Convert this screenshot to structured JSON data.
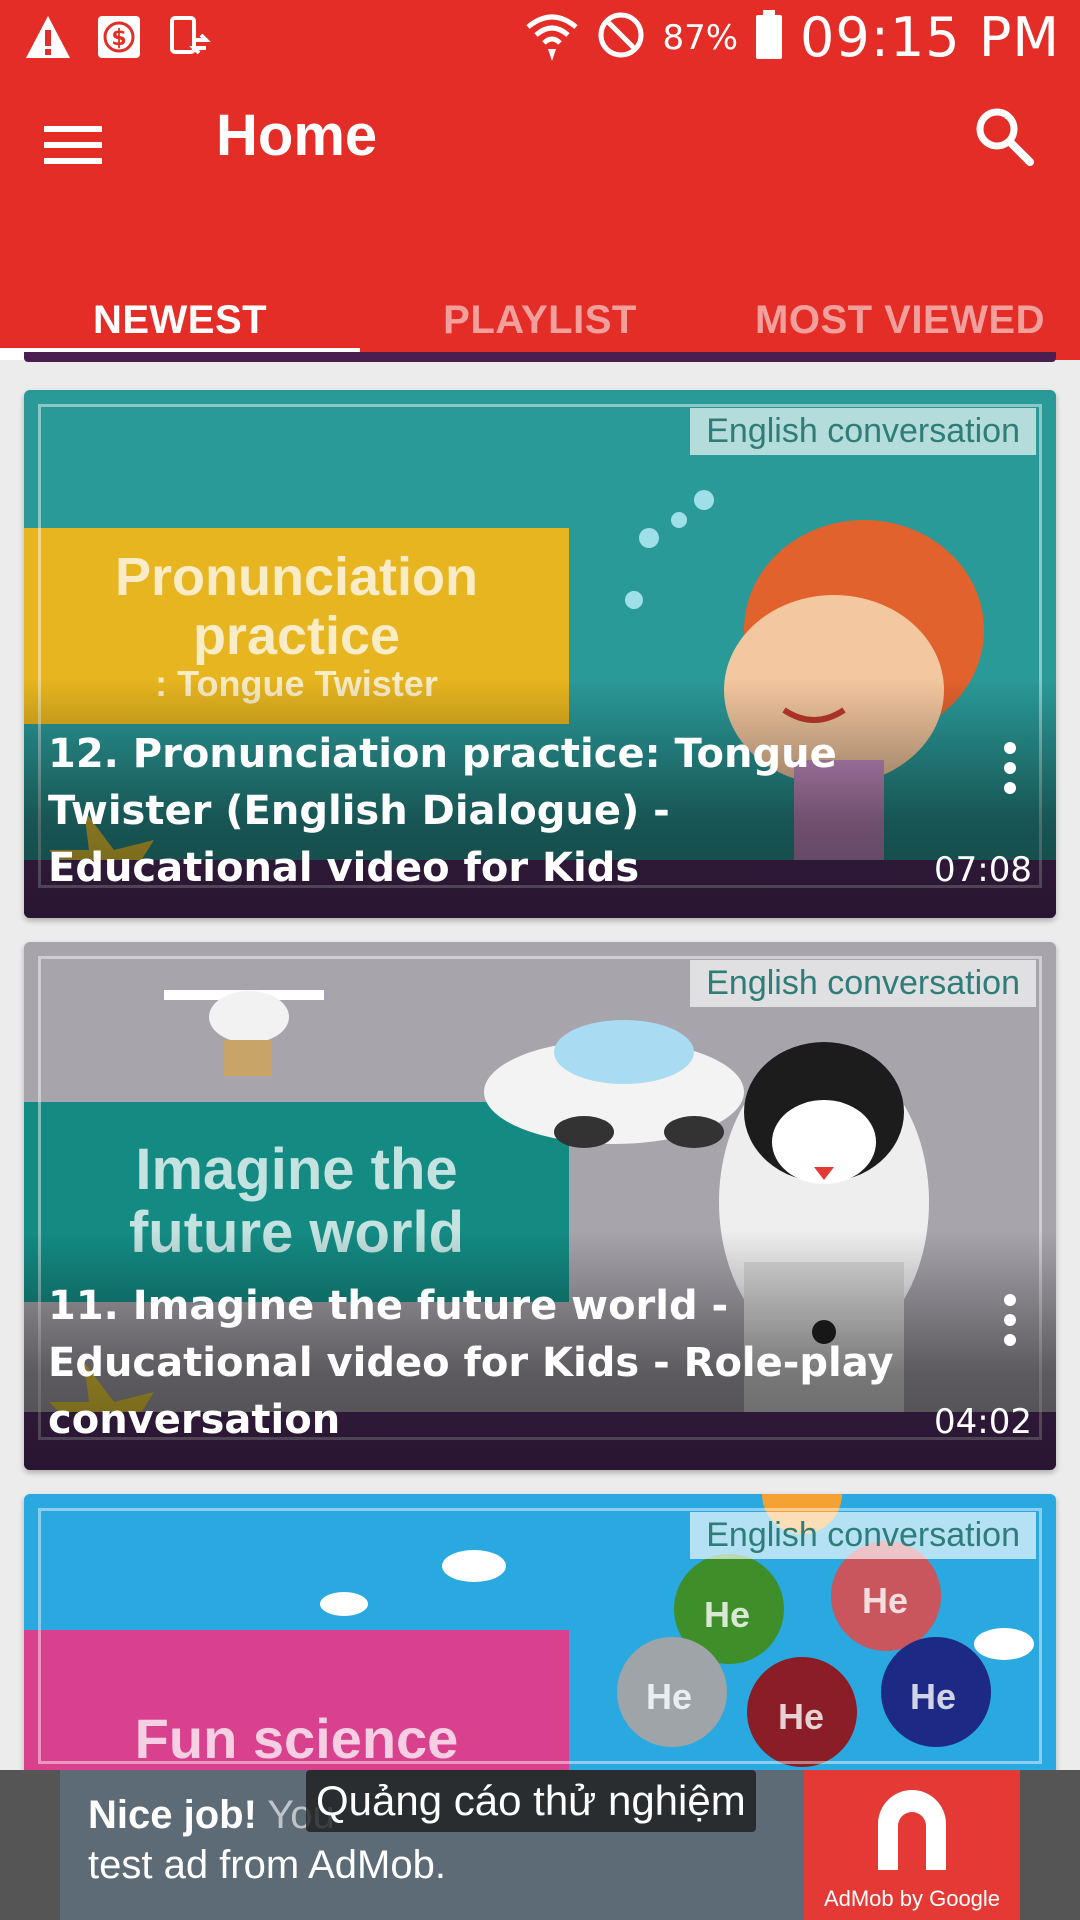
{
  "status_bar": {
    "battery": "87%",
    "time": "09:15 PM",
    "icons": [
      "warning-icon",
      "dollar-icon",
      "device-sync-icon",
      "wifi-icon",
      "blocked-icon",
      "battery-icon"
    ]
  },
  "app_bar": {
    "title": "Home",
    "color": "#e52d27"
  },
  "tabs": [
    {
      "label": "NEWEST",
      "active": true
    },
    {
      "label": "PLAYLIST",
      "active": false
    },
    {
      "label": "MOST VIEWED",
      "active": false
    }
  ],
  "videos": [
    {
      "tag": "English conversation",
      "thumb_lines": [
        "Pronunciation",
        "practice",
        ": Tongue Twister"
      ],
      "title": "12. Pronunciation practice: Tongue Twister (English Dialogue) - Educational video for Kids",
      "duration": "07:08"
    },
    {
      "tag": "English conversation",
      "thumb_lines": [
        "Imagine the",
        "future world"
      ],
      "title": "11. Imagine the future world - Educational video for Kids - Role-play conversation",
      "duration": "04:02"
    },
    {
      "tag": "English conversation",
      "thumb_lines": [
        "Fun science"
      ],
      "balloon_label": "He"
    }
  ],
  "ad": {
    "headline": "Nice job!",
    "body_start": "You",
    "body_end": "test ad from AdMob.",
    "brand": "AdMob by Google"
  },
  "toast": "Quảng cáo thử nghiệm"
}
